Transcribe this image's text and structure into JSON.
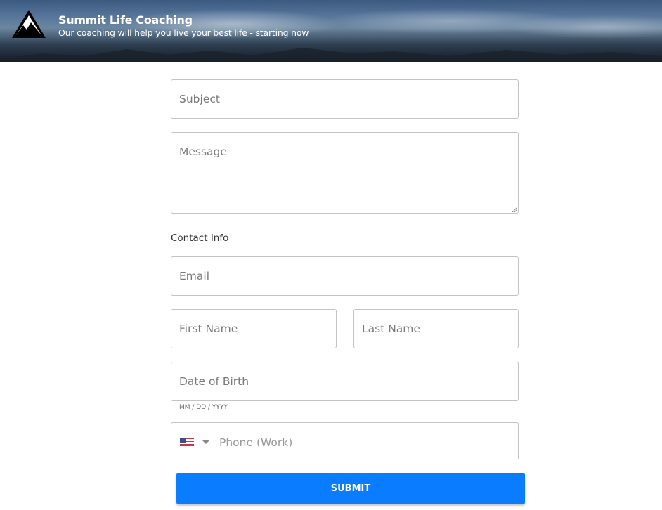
{
  "header": {
    "title": "Summit Life Coaching",
    "tagline": "Our coaching will help you live your best life - starting now",
    "logo_icon": "mountain-logo-icon"
  },
  "form": {
    "subject_placeholder": "Subject",
    "message_placeholder": "Message",
    "contact_section_label": "Contact Info",
    "email_placeholder": "Email",
    "first_name_placeholder": "First Name",
    "last_name_placeholder": "Last Name",
    "dob_placeholder": "Date of Birth",
    "dob_hint": "MM / DD / YYYY",
    "phone_placeholder": "Phone (Work)",
    "phone_country_icon": "us-flag-icon",
    "submit_label": "SUBMIT"
  },
  "colors": {
    "accent": "#0a7cff",
    "border": "#c4c4c4"
  }
}
